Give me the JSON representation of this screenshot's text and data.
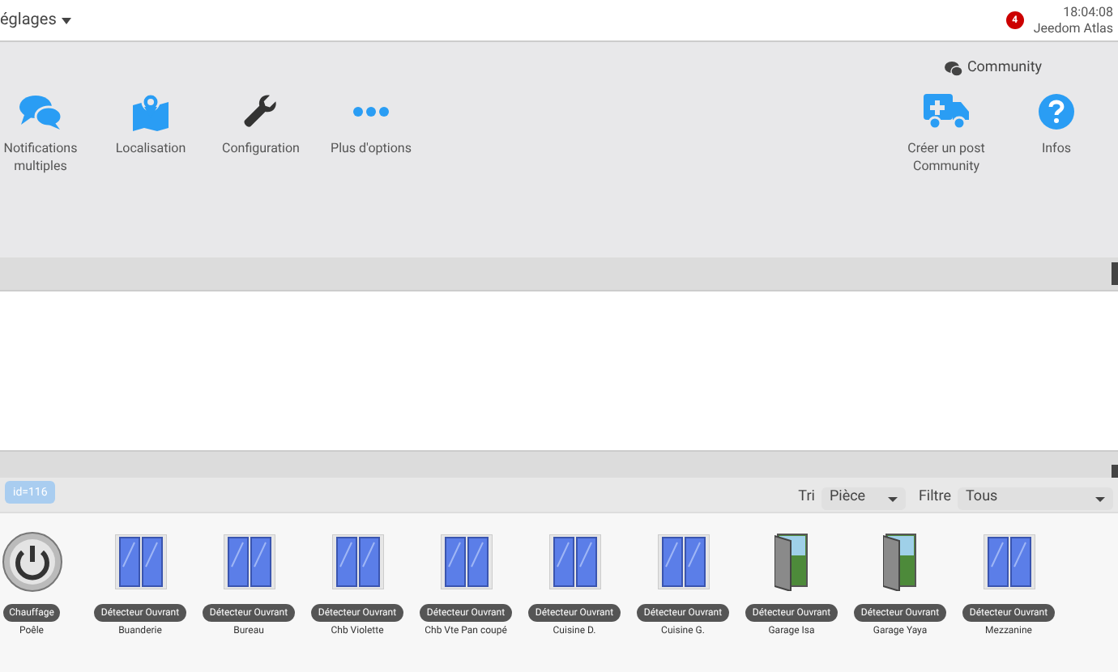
{
  "topbar": {
    "menu": "églages",
    "badge": "4",
    "time": "18:04:08",
    "user": "Jeedom Atlas"
  },
  "actions": [
    {
      "label": "Notifications multiples",
      "kind": "chat"
    },
    {
      "label": "Localisation",
      "kind": "map"
    },
    {
      "label": "Configuration",
      "kind": "wrench"
    },
    {
      "label": "Plus d'options",
      "kind": "dots"
    }
  ],
  "community": {
    "title": "Community",
    "actions": [
      {
        "label": "Créer un post Community",
        "kind": "truck"
      },
      {
        "label": "Infos",
        "kind": "help"
      }
    ]
  },
  "tooltip": "id=116",
  "sort": {
    "label": "Tri",
    "value": "Pièce"
  },
  "filter": {
    "label": "Filtre",
    "value": "Tous"
  },
  "equipment": [
    {
      "type": "Chauffage",
      "name": "Poêle",
      "kind": "power"
    },
    {
      "type": "Détecteur Ouvrant",
      "name": "Buanderie",
      "kind": "window"
    },
    {
      "type": "Détecteur Ouvrant",
      "name": "Bureau",
      "kind": "window"
    },
    {
      "type": "Détecteur Ouvrant",
      "name": "Chb Violette",
      "kind": "window"
    },
    {
      "type": "Détecteur Ouvrant",
      "name": "Chb Vte Pan coupé",
      "kind": "window"
    },
    {
      "type": "Détecteur Ouvrant",
      "name": "Cuisine D.",
      "kind": "window"
    },
    {
      "type": "Détecteur Ouvrant",
      "name": "Cuisine G.",
      "kind": "window"
    },
    {
      "type": "Détecteur Ouvrant",
      "name": "Garage Isa",
      "kind": "door"
    },
    {
      "type": "Détecteur Ouvrant",
      "name": "Garage Yaya",
      "kind": "door"
    },
    {
      "type": "Détecteur Ouvrant",
      "name": "Mezzanine",
      "kind": "window"
    }
  ]
}
